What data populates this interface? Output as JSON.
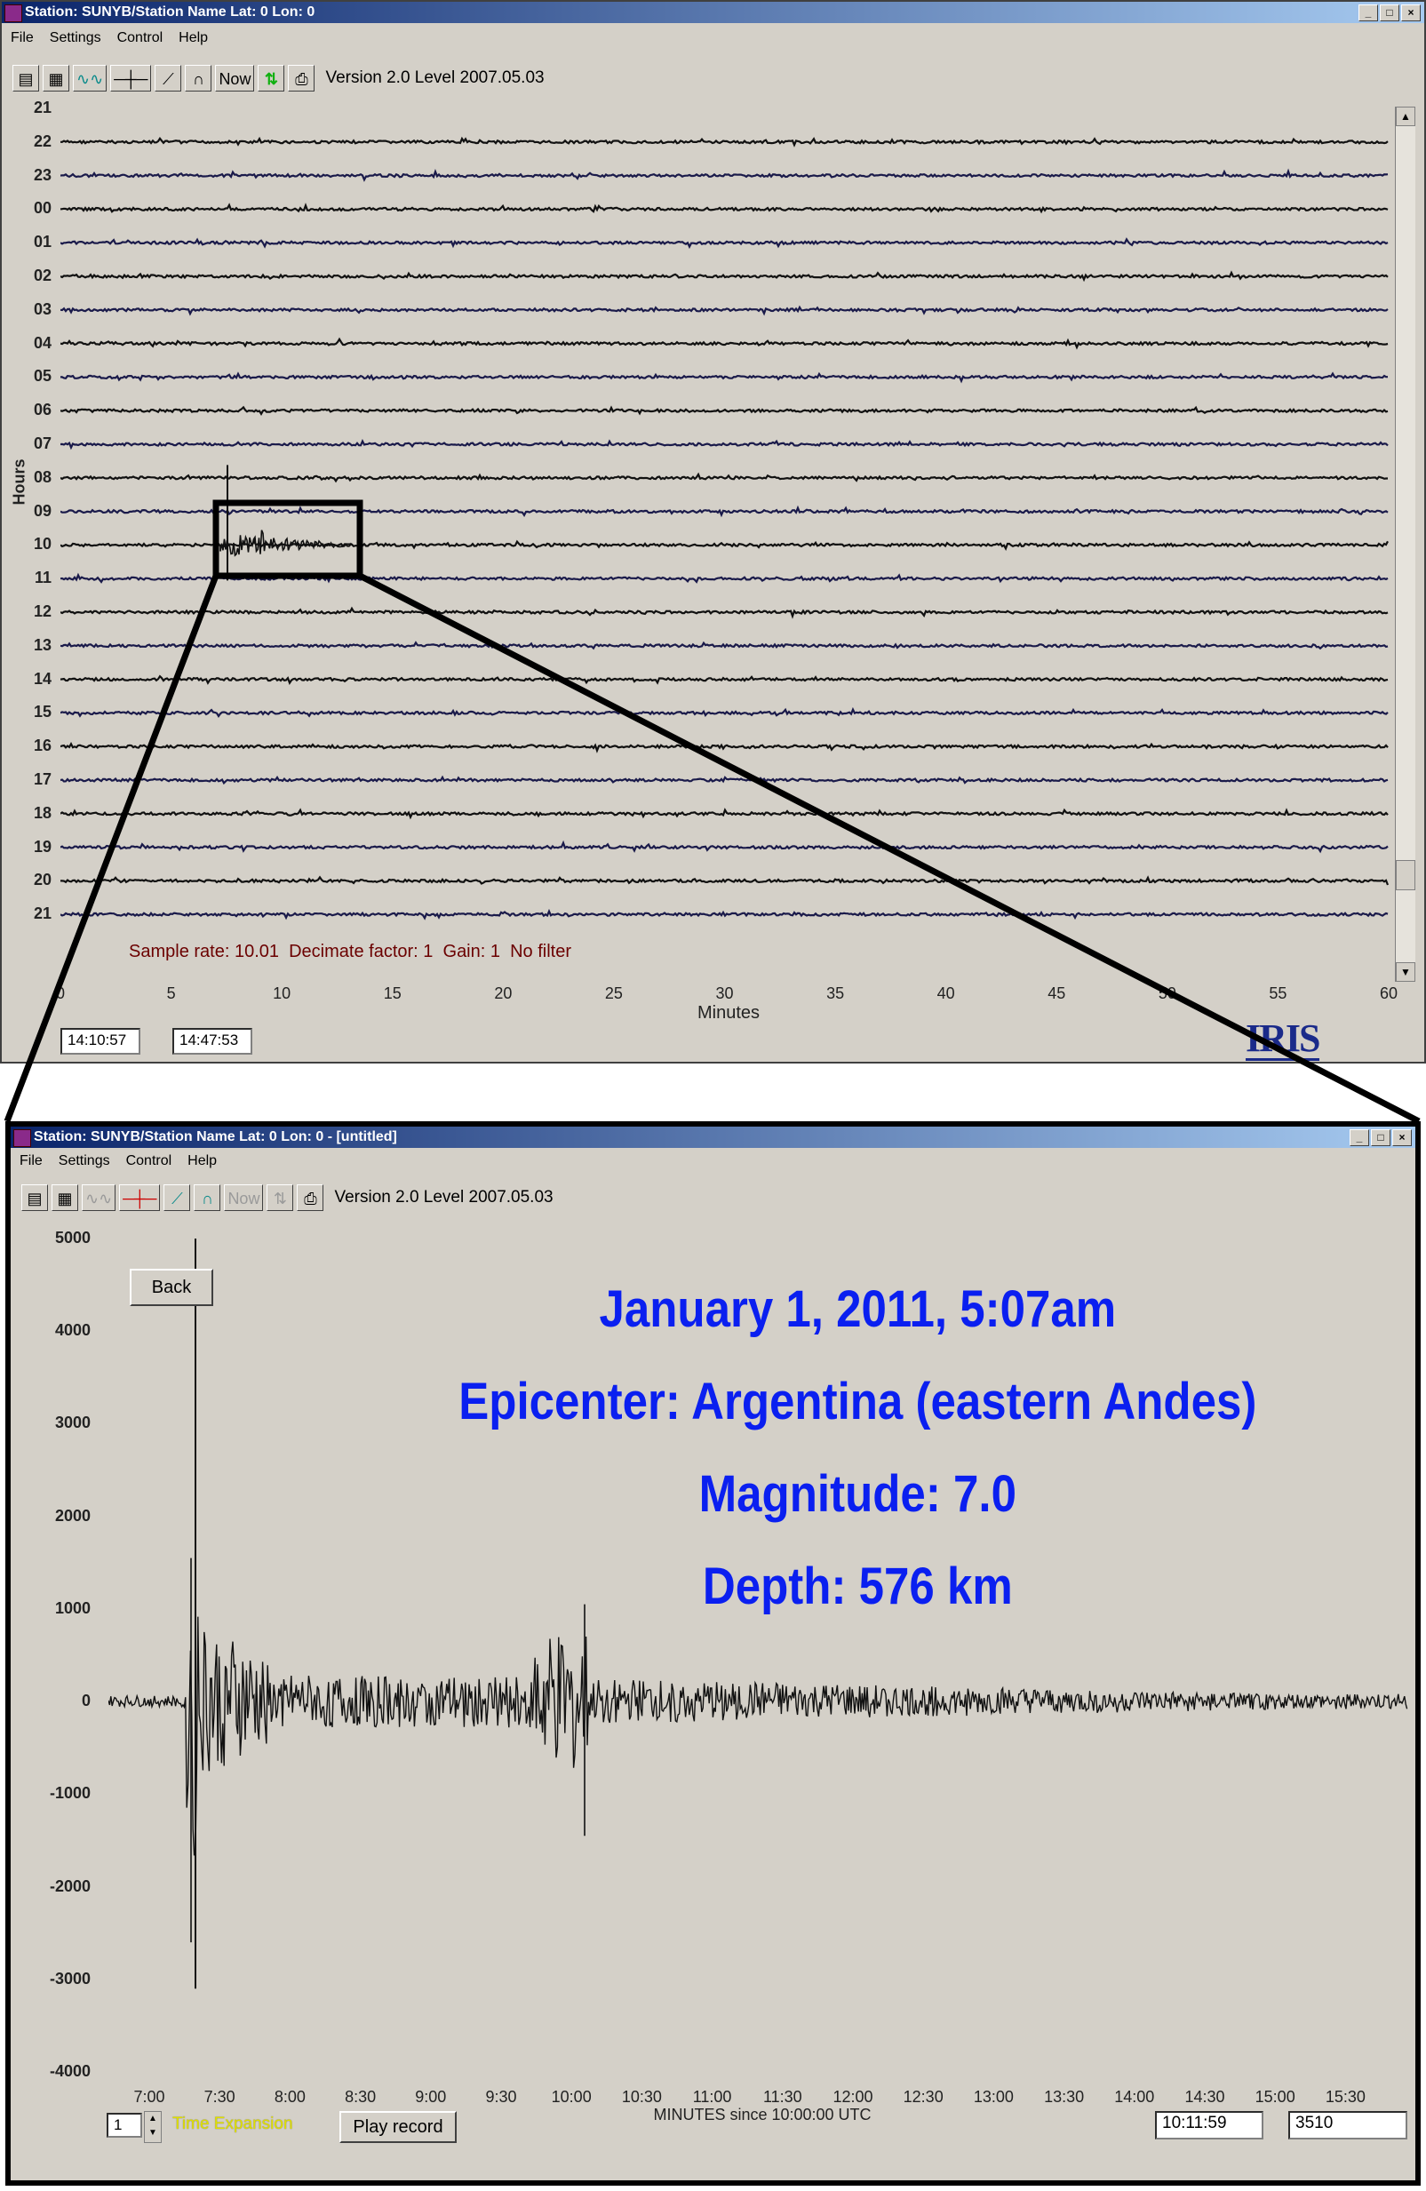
{
  "window1": {
    "title": "Station: SUNYB/Station Name Lat: 0 Lon: 0",
    "menu": [
      "File",
      "Settings",
      "Control",
      "Help"
    ],
    "toolbar": {
      "now_label": "Now",
      "version": "Version 2.0 Level 2007.05.03"
    },
    "date_stamp": "2011/01/01",
    "hour_labels": [
      "21",
      "22",
      "23",
      "00",
      "01",
      "02",
      "03",
      "04",
      "05",
      "06",
      "07",
      "08",
      "09",
      "10",
      "11",
      "12",
      "13",
      "14",
      "15",
      "16",
      "17",
      "18",
      "19",
      "20",
      "21"
    ],
    "y_axis_title": "Hours",
    "info_line": "Sample rate: 10.01  Decimate factor: 1  Gain: 1  No filter",
    "x_ticks": [
      "0",
      "5",
      "10",
      "15",
      "20",
      "25",
      "30",
      "35",
      "40",
      "45",
      "50",
      "55",
      "60"
    ],
    "x_axis_title": "Minutes",
    "time_field_1": "14:10:57",
    "time_field_2": "14:47:53",
    "logo": "IRIS"
  },
  "window2": {
    "title": "Station: SUNYB/Station Name Lat: 0 Lon: 0 - [untitled]",
    "menu": [
      "File",
      "Settings",
      "Control",
      "Help"
    ],
    "toolbar": {
      "now_label": "Now",
      "version": "Version 2.0 Level 2007.05.03"
    },
    "back_button": "Back",
    "y_ticks": [
      "5000",
      "4000",
      "3000",
      "2000",
      "1000",
      "0",
      "-1000",
      "-2000",
      "-3000",
      "-4000"
    ],
    "x_ticks": [
      "7:00",
      "7:30",
      "8:00",
      "8:30",
      "9:00",
      "9:30",
      "10:00",
      "10:30",
      "11:00",
      "11:30",
      "12:00",
      "12:30",
      "13:00",
      "13:30",
      "14:00",
      "14:30",
      "15:00",
      "15:30"
    ],
    "x_axis_title": "MINUTES since 10:00:00 UTC",
    "expansion_value": "1",
    "expansion_label": "Time Expansion",
    "play_button": "Play record",
    "time_field": "10:11:59",
    "count_field": "3510"
  },
  "event": {
    "line1": "January 1, 2011, 5:07am",
    "line2": "Epicenter: Argentina (eastern Andes)",
    "line3": "Magnitude: 7.0",
    "line4": "Depth: 576 km",
    "color": "#0a1ff0"
  }
}
